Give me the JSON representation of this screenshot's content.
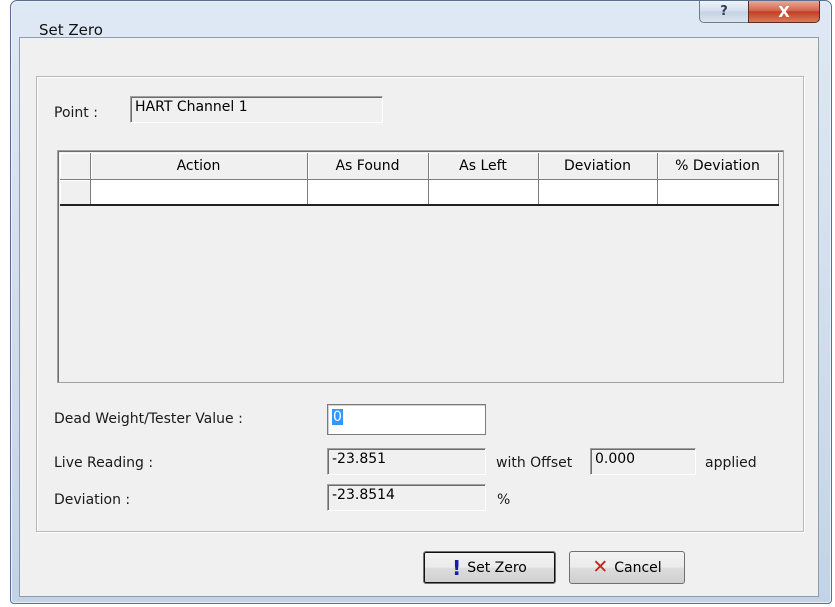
{
  "window": {
    "title": "Set Zero",
    "help_glyph": "?",
    "close_glyph": "X"
  },
  "point": {
    "label": "Point :",
    "value": "HART Channel 1"
  },
  "grid": {
    "columns": [
      "Action",
      "As Found",
      "As Left",
      "Deviation",
      "% Deviation"
    ],
    "rows": [
      [
        "",
        "",
        "",
        "",
        ""
      ]
    ]
  },
  "dead_weight": {
    "label": "Dead Weight/Tester Value :",
    "value": "0"
  },
  "live_reading": {
    "label": "Live Reading :",
    "value": "-23.851",
    "with_offset_label": "with Offset",
    "offset_value": "0.000",
    "applied_label": "applied"
  },
  "deviation": {
    "label": "Deviation :",
    "value": "-23.8514",
    "unit": "%"
  },
  "buttons": {
    "set_zero": "Set Zero",
    "cancel": "Cancel"
  },
  "colors": {
    "cancel_icon": "#c4261a",
    "set_zero_icon": "#1a1aa8"
  }
}
